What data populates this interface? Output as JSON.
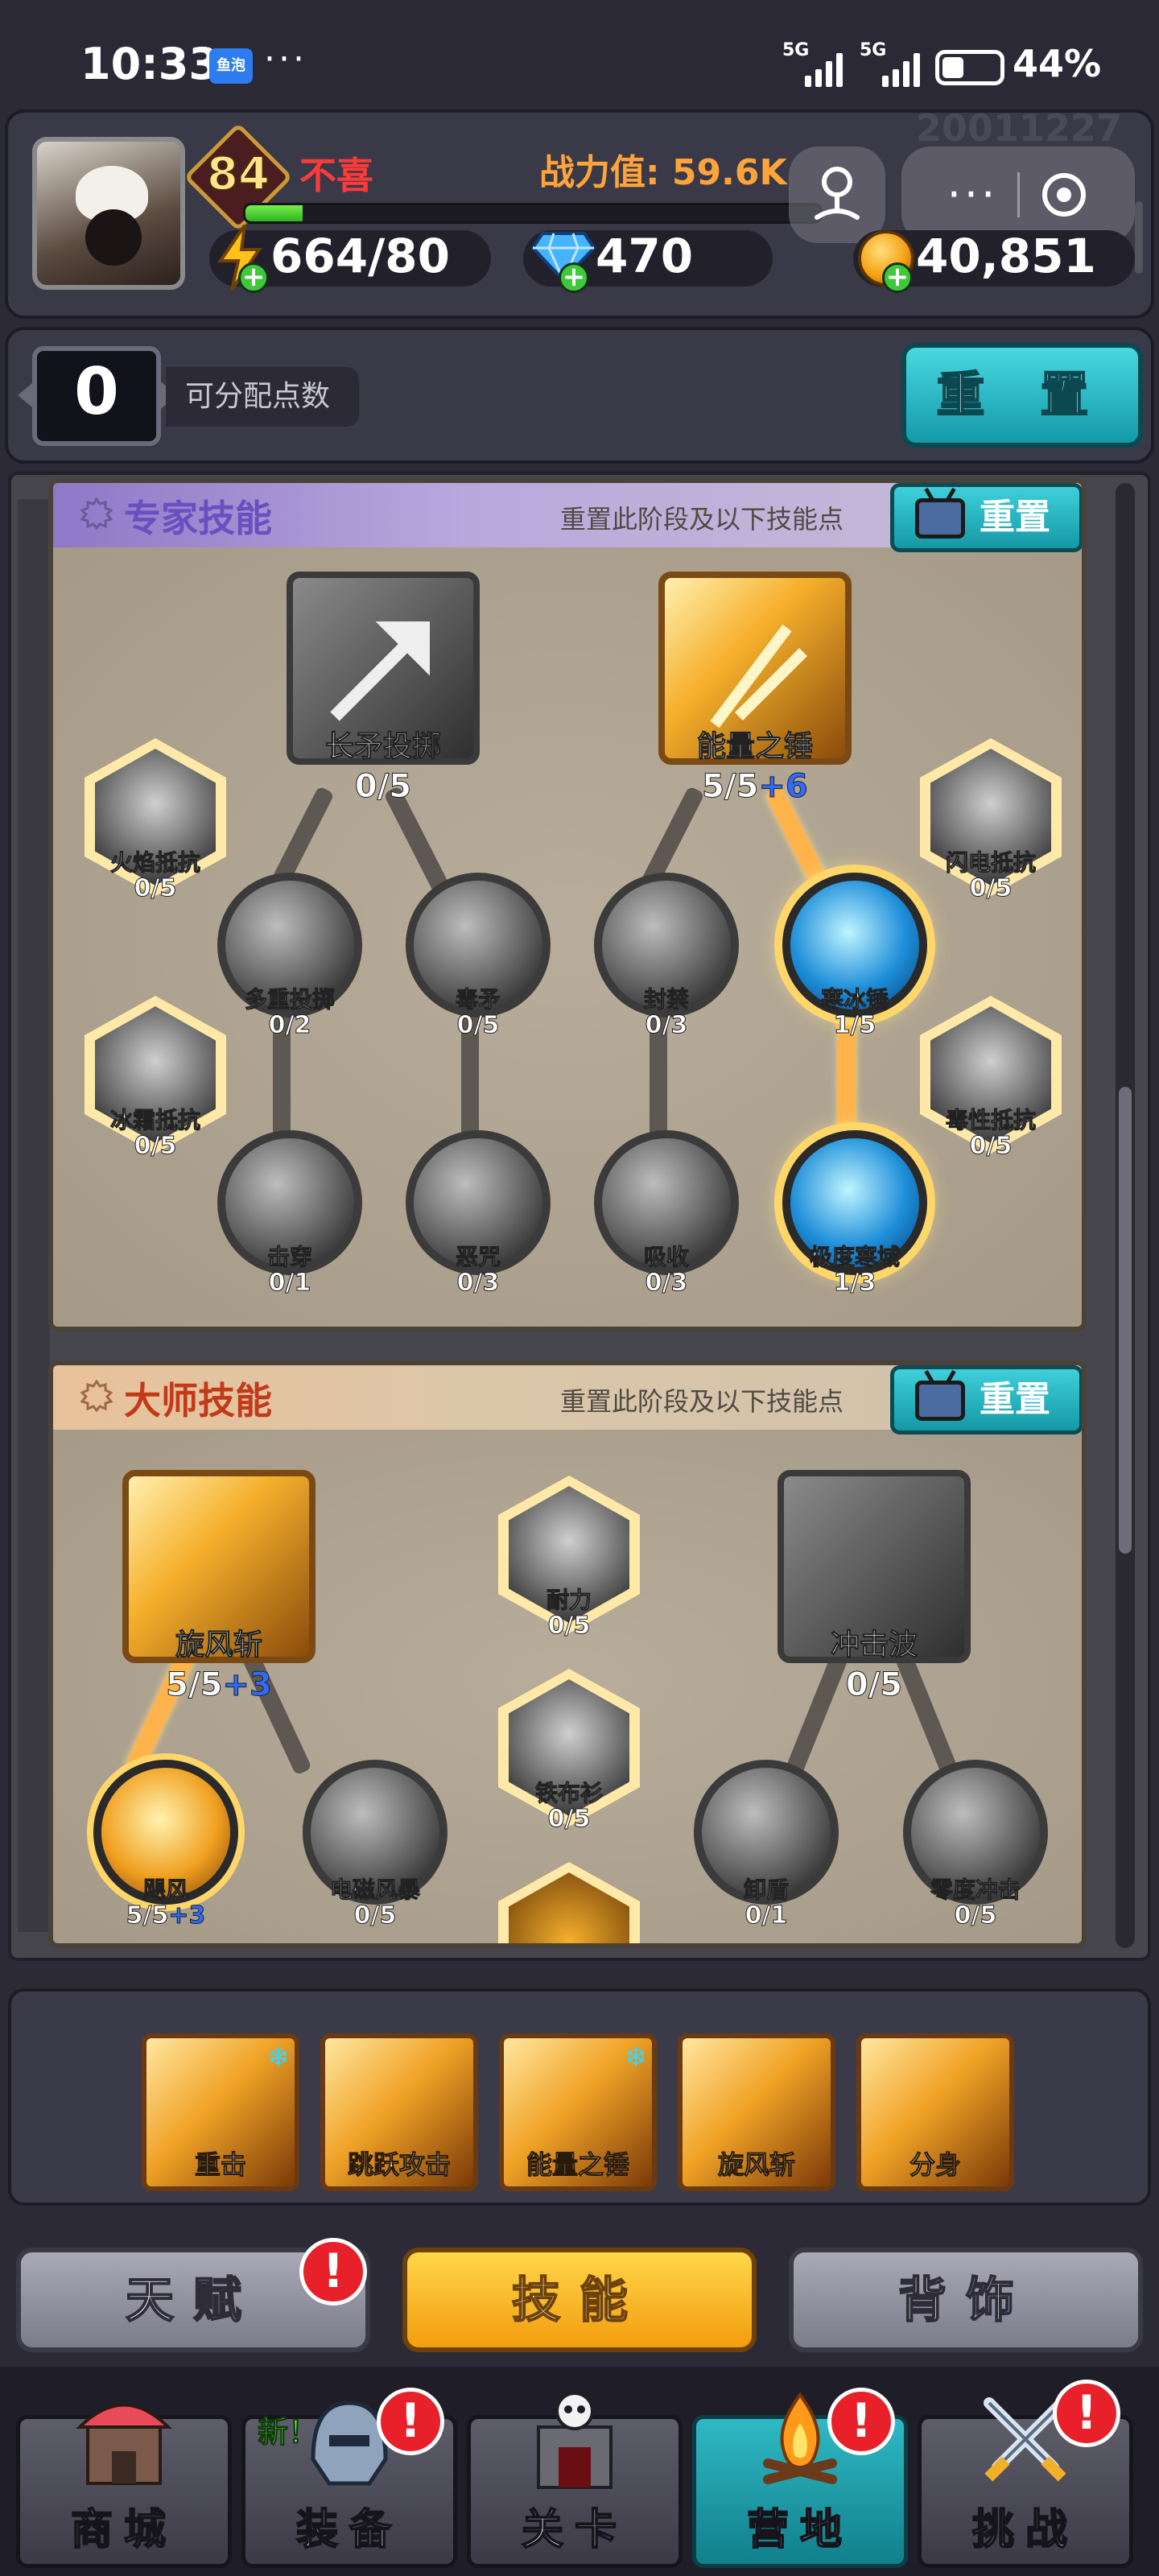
{
  "status_bar": {
    "time": "10:33",
    "app_badge": "鱼泡",
    "more": "···",
    "net1": "5G",
    "net2": "5G",
    "battery_pct": "44%"
  },
  "player": {
    "level": "84",
    "name": "不喜",
    "power": "战力值: 59.6K",
    "faint_id": "20011227",
    "xp_progress": 0.1,
    "energy": "664/80",
    "gems": "470",
    "gold": "40,851"
  },
  "points": {
    "value": "0",
    "label": "可分配点数",
    "reset_label": "重 置"
  },
  "sections": {
    "expert": {
      "title": "专家技能",
      "hint": "重置此阶段及以下技能点",
      "reset_label": "重置",
      "nodes": {
        "spear": {
          "label": "长矛投掷",
          "count": "0/5"
        },
        "hammer": {
          "label": "能量之锤",
          "count": "5/5",
          "bonus": "+6"
        },
        "fire_res": {
          "label": "火焰抵抗",
          "count": "0/5"
        },
        "lightning_res": {
          "label": "闪电抵抗",
          "count": "0/5"
        },
        "multi_spear": {
          "label": "多重投掷",
          "count": "0/2"
        },
        "poison_spear": {
          "label": "毒矛",
          "count": "0/5"
        },
        "seal": {
          "label": "封禁",
          "count": "0/3"
        },
        "frost_hammer": {
          "label": "寒冰锤",
          "count": "1/5"
        },
        "frost_res": {
          "label": "冰霜抵抗",
          "count": "0/5"
        },
        "toxic_res": {
          "label": "毒性抵抗",
          "count": "0/5"
        },
        "pierce": {
          "label": "击穿",
          "count": "0/1"
        },
        "curse": {
          "label": "恶咒",
          "count": "0/3"
        },
        "absorb": {
          "label": "吸收",
          "count": "0/3"
        },
        "extreme_cold": {
          "label": "极度寒域",
          "count": "1/3"
        }
      }
    },
    "master": {
      "title": "大师技能",
      "hint": "重置此阶段及以下技能点",
      "reset_label": "重置",
      "nodes": {
        "whirlwind": {
          "label": "旋风斩",
          "count": "5/5",
          "bonus": "+3"
        },
        "endurance": {
          "label": "耐力",
          "count": "0/5"
        },
        "shockwave": {
          "label": "冲击波",
          "count": "0/5"
        },
        "iron_shirt": {
          "label": "铁布衫",
          "count": "0/5"
        },
        "hurricane": {
          "label": "飓风",
          "count": "5/5",
          "bonus": "+3"
        },
        "em_storm": {
          "label": "电磁风暴",
          "count": "0/5"
        },
        "unload_shield": {
          "label": "卸盾",
          "count": "0/1"
        },
        "zero_impact": {
          "label": "零度冲击",
          "count": "0/5"
        }
      }
    }
  },
  "equipped": [
    {
      "label": "重击",
      "frost": true
    },
    {
      "label": "跳跃攻击",
      "frost": false
    },
    {
      "label": "能量之锤",
      "frost": true
    },
    {
      "label": "旋风斩",
      "frost": false
    },
    {
      "label": "分身",
      "frost": false
    }
  ],
  "tabs": {
    "talent": "天赋",
    "skill": "技能",
    "accessory": "背饰",
    "alert": "!"
  },
  "nav": {
    "shop": "商城",
    "equip": "装备",
    "stage": "关卡",
    "camp": "营地",
    "challenge": "挑战",
    "new_tag": "新！"
  },
  "colors": {
    "accent_teal": "#1ea8b4",
    "accent_gold": "#f5a623",
    "alert_red": "#e8202a"
  }
}
